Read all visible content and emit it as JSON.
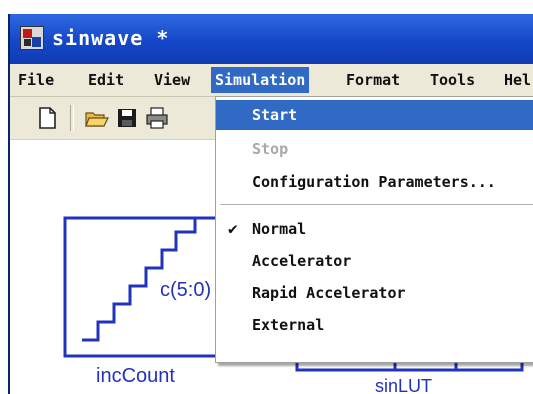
{
  "window": {
    "title": "sinwave *"
  },
  "menubar": {
    "items": [
      {
        "label": "File",
        "id": "file"
      },
      {
        "label": "Edit",
        "id": "edit"
      },
      {
        "label": "View",
        "id": "view"
      },
      {
        "label": "Simulation",
        "id": "simulation",
        "active": true
      },
      {
        "label": "Format",
        "id": "format"
      },
      {
        "label": "Tools",
        "id": "tools"
      },
      {
        "label": "Hel",
        "id": "help"
      }
    ]
  },
  "toolbar": {
    "buttons": [
      {
        "name": "new-file-icon"
      },
      {
        "name": "open-folder-icon"
      },
      {
        "name": "save-icon"
      },
      {
        "name": "print-icon"
      }
    ]
  },
  "canvas": {
    "blocks": [
      {
        "name": "inc-count-block",
        "port_label": "c(5:0)",
        "label": "incCount"
      },
      {
        "name": "sin-lut-block",
        "label": "sinLUT"
      }
    ]
  },
  "simulation_menu": {
    "items": [
      {
        "label": "Start",
        "state": "highlighted"
      },
      {
        "label": "Stop",
        "state": "disabled"
      },
      {
        "label": "Configuration Parameters...",
        "state": "normal"
      },
      {
        "label": "Normal",
        "state": "checked"
      },
      {
        "label": "Accelerator",
        "state": "normal"
      },
      {
        "label": "Rapid Accelerator",
        "state": "normal"
      },
      {
        "label": "External",
        "state": "normal"
      }
    ]
  },
  "colors": {
    "titlebar": "#1447c8",
    "menu_highlight": "#316ac5",
    "block_stroke": "#2233bb",
    "disabled_text": "#a8a8a8"
  }
}
